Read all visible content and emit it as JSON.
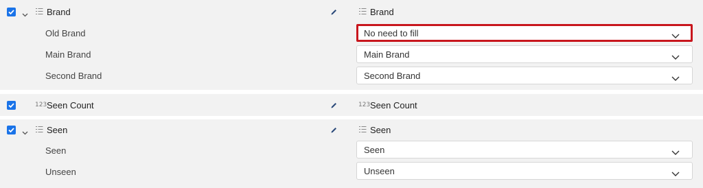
{
  "groups": [
    {
      "field": {
        "type_icon": "list-type-icon",
        "name": "Brand",
        "mapped_name": "Brand",
        "checked": true
      },
      "values": [
        {
          "label": "Old Brand",
          "selected": "No need to fill"
        },
        {
          "label": "Main Brand",
          "selected": "Main Brand"
        },
        {
          "label": "Second Brand",
          "selected": "Second Brand"
        }
      ]
    },
    {
      "field": {
        "type_icon": "number-type-icon",
        "type_glyph": "123",
        "name": "Seen Count",
        "mapped_name": "Seen Count",
        "checked": true
      }
    },
    {
      "field": {
        "type_icon": "list-type-icon",
        "name": "Seen",
        "mapped_name": "Seen",
        "checked": true
      },
      "values": [
        {
          "label": "Seen",
          "selected": "Seen"
        },
        {
          "label": "Unseen",
          "selected": "Unseen"
        }
      ]
    }
  ],
  "colors": {
    "checkbox": "#1a73e8",
    "highlight": "#c8161d",
    "row_bg": "#f2f2f2"
  }
}
